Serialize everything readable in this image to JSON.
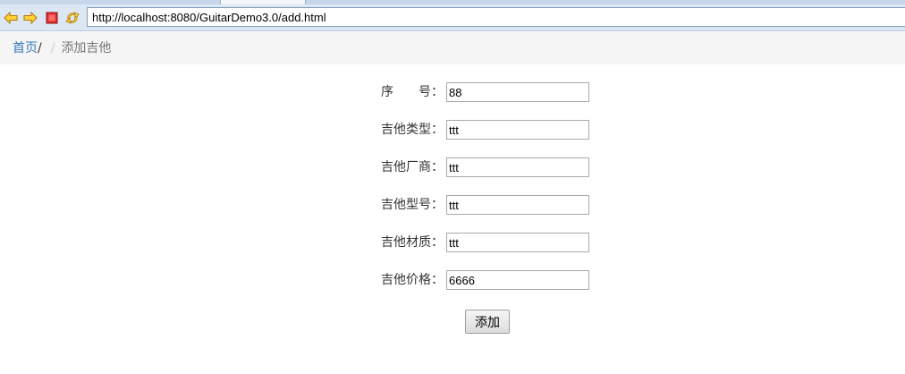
{
  "browser": {
    "url": "http://localhost:8080/GuitarDemo3.0/add.html",
    "icons": [
      "back-arrow-icon",
      "forward-arrow-icon",
      "stop-icon",
      "refresh-icon"
    ],
    "colors": {
      "arrow": "#f0b000",
      "stop": "#d42020",
      "toolbar": "#dde7f3"
    }
  },
  "breadcrumb": {
    "home": "首页",
    "separator": "/",
    "separator2": "/",
    "current": "添加吉他"
  },
  "form": {
    "fields": [
      {
        "label": "序　　号：",
        "value": "88"
      },
      {
        "label": "吉他类型：",
        "value": "ttt"
      },
      {
        "label": "吉他厂商：",
        "value": "ttt"
      },
      {
        "label": "吉他型号：",
        "value": "ttt"
      },
      {
        "label": "吉他材质：",
        "value": "ttt"
      },
      {
        "label": "吉他价格：",
        "value": "6666"
      }
    ],
    "submit_label": "添加"
  }
}
